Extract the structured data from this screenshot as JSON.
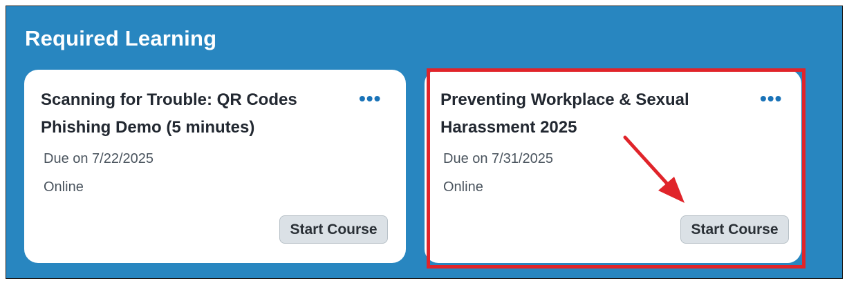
{
  "section": {
    "title": "Required Learning"
  },
  "cards": [
    {
      "title_line1": "Scanning for Trouble: QR Codes",
      "title_line2": "Phishing Demo (5 minutes)",
      "more_label": "•••",
      "due": "Due on 7/22/2025",
      "mode": "Online",
      "button_label": "Start Course"
    },
    {
      "title_line1": "Preventing Workplace & Sexual",
      "title_line2": "Harassment 2025",
      "more_label": "•••",
      "due": "Due on 7/31/2025",
      "mode": "Online",
      "button_label": "Start Course"
    }
  ],
  "annotation": {
    "highlight_color": "#e0242a",
    "arrow_color": "#e0242a"
  },
  "colors": {
    "panel_background": "#2886c0",
    "card_background": "#ffffff",
    "button_background": "#dbe1e6",
    "more_icon": "#1a73b8"
  }
}
